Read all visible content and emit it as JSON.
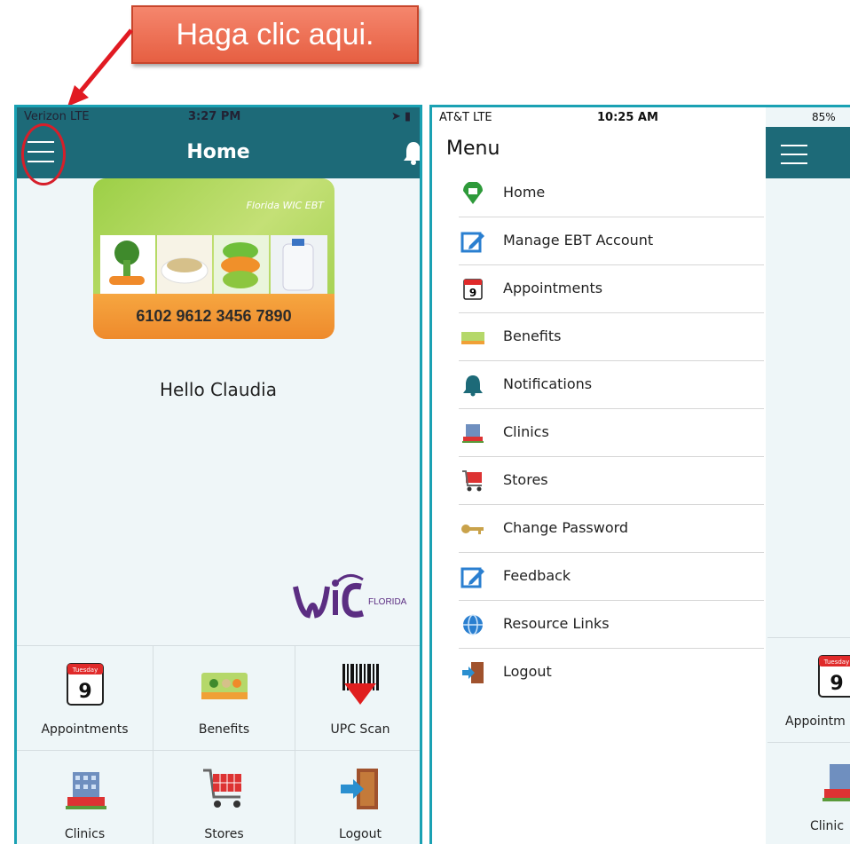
{
  "callout": {
    "text": "Haga clic aqui."
  },
  "left_phone": {
    "status": {
      "carrier": "Verizon  LTE",
      "time": "3:27 PM"
    },
    "nav": {
      "title": "Home"
    },
    "card": {
      "brand": "Florida WIC EBT",
      "number": "6102 9612 3456 7890"
    },
    "greeting": "Hello Claudia",
    "logo": {
      "wic": "WIC",
      "state": "FLORIDA"
    },
    "tiles": [
      {
        "label": "Appointments",
        "icon": "calendar-icon",
        "day": "Tuesday",
        "date": "9"
      },
      {
        "label": "Benefits",
        "icon": "benefits-card-icon"
      },
      {
        "label": "UPC Scan",
        "icon": "barcode-scan-icon"
      },
      {
        "label": "Clinics",
        "icon": "clinic-building-icon"
      },
      {
        "label": "Stores",
        "icon": "shopping-cart-icon"
      },
      {
        "label": "Logout",
        "icon": "logout-door-icon"
      }
    ]
  },
  "right_phone": {
    "status": {
      "carrier": "AT&T  LTE",
      "time": "10:25 AM",
      "battery": "85%"
    },
    "menu_title": "Menu",
    "menu_items": [
      {
        "label": "Home",
        "icon": "home-pin-icon"
      },
      {
        "label": "Manage EBT Account",
        "icon": "edit-icon"
      },
      {
        "label": "Appointments",
        "icon": "calendar-icon"
      },
      {
        "label": "Benefits",
        "icon": "benefits-card-icon"
      },
      {
        "label": "Notifications",
        "icon": "bell-icon"
      },
      {
        "label": "Clinics",
        "icon": "clinic-building-icon"
      },
      {
        "label": "Stores",
        "icon": "shopping-cart-icon"
      },
      {
        "label": "Change Password",
        "icon": "key-icon"
      },
      {
        "label": "Feedback",
        "icon": "edit-icon"
      },
      {
        "label": "Resource Links",
        "icon": "globe-icon"
      },
      {
        "label": "Logout",
        "icon": "logout-door-icon"
      }
    ],
    "peek": {
      "calendar_day": "Tuesday",
      "calendar_date": "9",
      "tile1_label": "Appointm",
      "tile2_label": "Clinic"
    }
  },
  "colors": {
    "nav_teal": "#1d6a78",
    "frame": "#1aa1b3",
    "callout": "#e65f42",
    "highlight_red": "#d61f2a"
  }
}
